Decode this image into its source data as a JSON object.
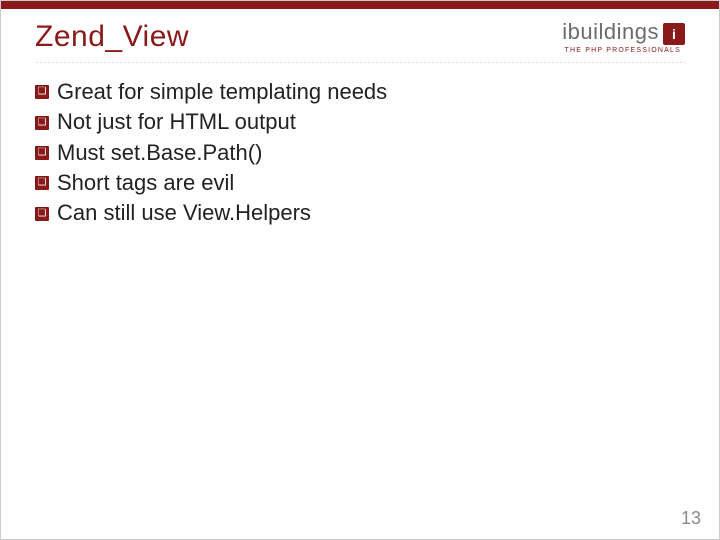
{
  "accent_color": "#8a1a1a",
  "header": {
    "title": "Zend_View",
    "logo": {
      "text": "ibuildings",
      "badge": "i",
      "tagline": "THE PHP PROFESSIONALS"
    }
  },
  "bullets": [
    "Great for simple templating needs",
    "Not just for HTML output",
    "Must set.Base.Path()",
    "Short tags are evil",
    "Can still use View.Helpers"
  ],
  "page_number": "13"
}
